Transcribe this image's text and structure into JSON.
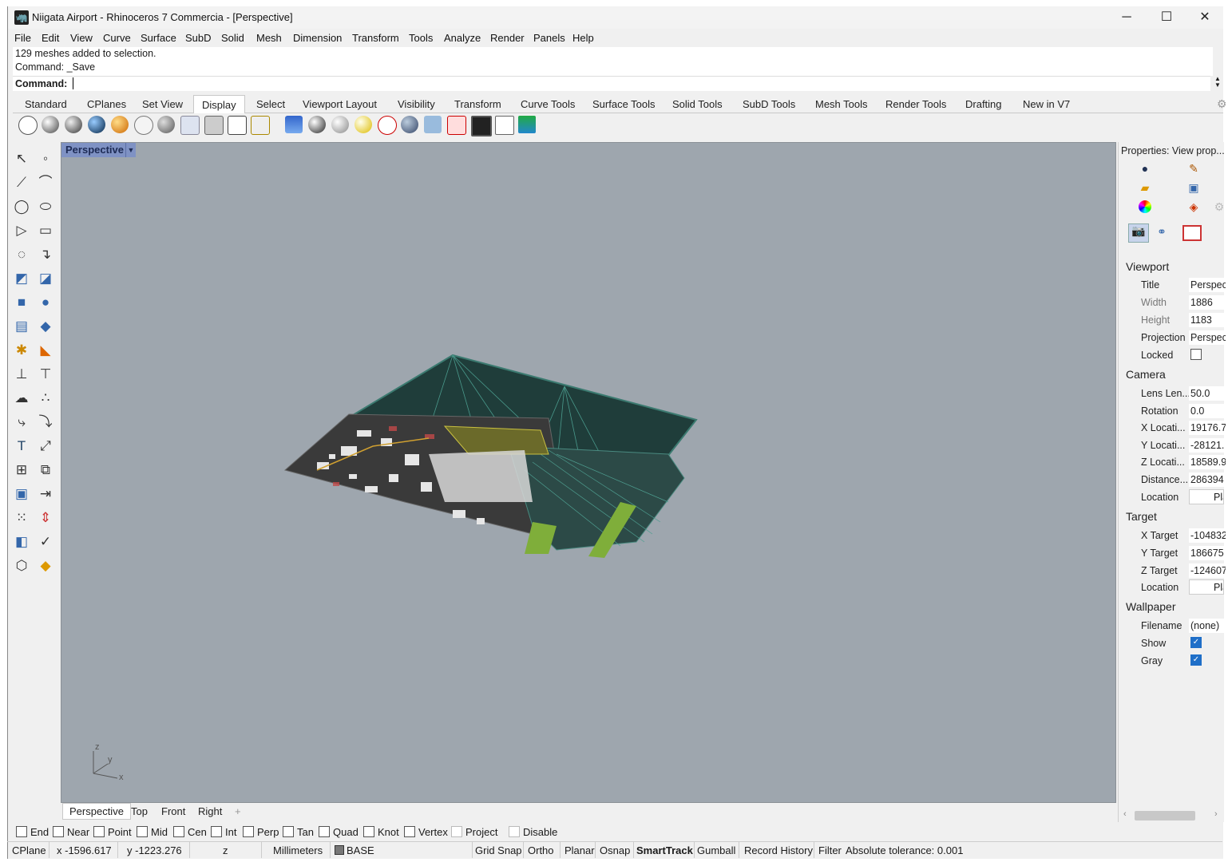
{
  "window": {
    "title": "Niigata Airport - Rhinoceros 7 Commercia - [Perspective]",
    "minimize": "─",
    "maximize": "☐",
    "close": "✕"
  },
  "menu": [
    "File",
    "Edit",
    "View",
    "Curve",
    "Surface",
    "SubD",
    "Solid",
    "Mesh",
    "Dimension",
    "Transform",
    "Tools",
    "Analyze",
    "Render",
    "Panels",
    "Help"
  ],
  "command": {
    "history": [
      "129 meshes added to selection.",
      "Command: _Save"
    ],
    "prompt": "Command:",
    "value": ""
  },
  "toolbar_tabs": [
    "Standard",
    "CPlanes",
    "Set View",
    "Display",
    "Select",
    "Viewport Layout",
    "Visibility",
    "Transform",
    "Curve Tools",
    "Surface Tools",
    "Solid Tools",
    "SubD Tools",
    "Mesh Tools",
    "Render Tools",
    "Drafting",
    "New in V7"
  ],
  "active_tab": "Display",
  "viewport": {
    "name": "Perspective",
    "background": "#9ea6ae",
    "axis": {
      "z": "z",
      "y": "y",
      "x": "x"
    }
  },
  "viewport_tabs": [
    "Perspective",
    "Top",
    "Front",
    "Right"
  ],
  "viewport_tab_add": "+",
  "properties": {
    "title": "Properties: View prop...",
    "viewport_section": "Viewport",
    "viewport": [
      {
        "label": "Title",
        "value": "Perspective"
      },
      {
        "label": "Width",
        "value": "1886"
      },
      {
        "label": "Height",
        "value": "1183"
      },
      {
        "label": "Projection",
        "value": "Perspective"
      },
      {
        "label": "Locked",
        "value": ""
      }
    ],
    "camera_section": "Camera",
    "camera": [
      {
        "label": "Lens Len...",
        "value": "50.0"
      },
      {
        "label": "Rotation",
        "value": "0.0"
      },
      {
        "label": "X Locati...",
        "value": "19176.7"
      },
      {
        "label": "Y Locati...",
        "value": "-28121."
      },
      {
        "label": "Z Locati...",
        "value": "18589.9"
      },
      {
        "label": "Distance...",
        "value": "286394"
      },
      {
        "label": "Location",
        "value": "Place"
      }
    ],
    "target_section": "Target",
    "target": [
      {
        "label": "X Target",
        "value": "-104832"
      },
      {
        "label": "Y Target",
        "value": "186675"
      },
      {
        "label": "Z Target",
        "value": "-124607"
      },
      {
        "label": "Location",
        "value": "Place"
      }
    ],
    "wallpaper_section": "Wallpaper",
    "wallpaper": [
      {
        "label": "Filename",
        "value": "(none)"
      },
      {
        "label": "Show",
        "value": ""
      },
      {
        "label": "Gray",
        "value": ""
      }
    ],
    "locked_checked": false,
    "show_checked": true,
    "gray_checked": true
  },
  "osnaps": [
    {
      "label": "End",
      "checked": false
    },
    {
      "label": "Near",
      "checked": false
    },
    {
      "label": "Point",
      "checked": false
    },
    {
      "label": "Mid",
      "checked": false
    },
    {
      "label": "Cen",
      "checked": false
    },
    {
      "label": "Int",
      "checked": false
    },
    {
      "label": "Perp",
      "checked": false
    },
    {
      "label": "Tan",
      "checked": false
    },
    {
      "label": "Quad",
      "checked": false
    },
    {
      "label": "Knot",
      "checked": false
    },
    {
      "label": "Vertex",
      "checked": false
    },
    {
      "label": "Project",
      "checked": false
    },
    {
      "label": "Disable",
      "checked": false
    }
  ],
  "status": {
    "cplane": "CPlane",
    "x": "x -1596.617",
    "y": "y -1223.276",
    "z": "z",
    "units": "Millimeters",
    "layer": "BASE",
    "grid_snap": "Grid Snap",
    "ortho": "Ortho",
    "planar": "Planar",
    "osnap": "Osnap",
    "smarttrack": "SmartTrack",
    "gumball": "Gumball",
    "record_history": "Record History",
    "filter": "Filter",
    "tolerance": "Absolute tolerance: 0.001"
  }
}
